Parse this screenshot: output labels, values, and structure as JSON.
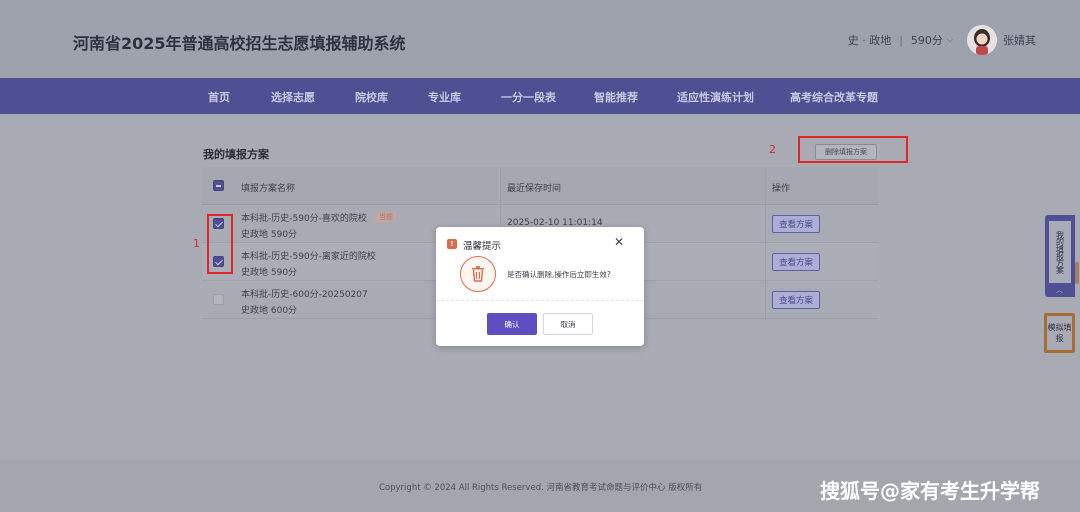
{
  "header": {
    "site_title": "河南省2025年普通高校招生志愿填报辅助系统",
    "subject": "史 · 政地",
    "separator": "|",
    "score": "590分",
    "username": "张婧其"
  },
  "nav": {
    "items": [
      "首页",
      "选择志愿",
      "院校库",
      "专业库",
      "一分一段表",
      "智能推荐",
      "适应性演练计划",
      "高考综合改革专题"
    ]
  },
  "main": {
    "section_title": "我的填报方案",
    "delete_button_label": "删除填报方案",
    "table": {
      "columns": [
        "填报方案名称",
        "最近保存时间",
        "操作"
      ],
      "rows": [
        {
          "name": "本科批-历史-590分-喜欢的院校",
          "tag": "当前",
          "subtitle": "史政地 590分",
          "saved_at": "2025-02-10 11:01:14",
          "action": "查看方案",
          "checked": true
        },
        {
          "name": "本科批-历史-590分-离家近的院校",
          "tag": "",
          "subtitle": "史政地 590分",
          "saved_at": "",
          "action": "查看方案",
          "checked": true
        },
        {
          "name": "本科批-历史-600分-20250207",
          "tag": "",
          "subtitle": "史政地 600分",
          "saved_at": "",
          "action": "查看方案",
          "checked": false
        }
      ]
    },
    "annotations": {
      "label_1": "1",
      "label_2": "2"
    }
  },
  "side": {
    "my_plans_tab": "我的填报方案",
    "mock_fill_tab": "模拟填报"
  },
  "footer": {
    "copyright": "Copyright © 2024 All Rights Reserved. 河南省教育考试命题与评价中心 版权所有",
    "watermark": "搜狐号@家有考生升学帮"
  },
  "modal": {
    "title": "温馨提示",
    "message": "是否确认删除,操作后立即生效?",
    "confirm_label": "确认",
    "cancel_label": "取消"
  },
  "colors": {
    "nav_bg": "#4f4f93",
    "accent": "#5d4fc2",
    "warning": "#e06a4c",
    "annotation_red": "#e0262a"
  }
}
